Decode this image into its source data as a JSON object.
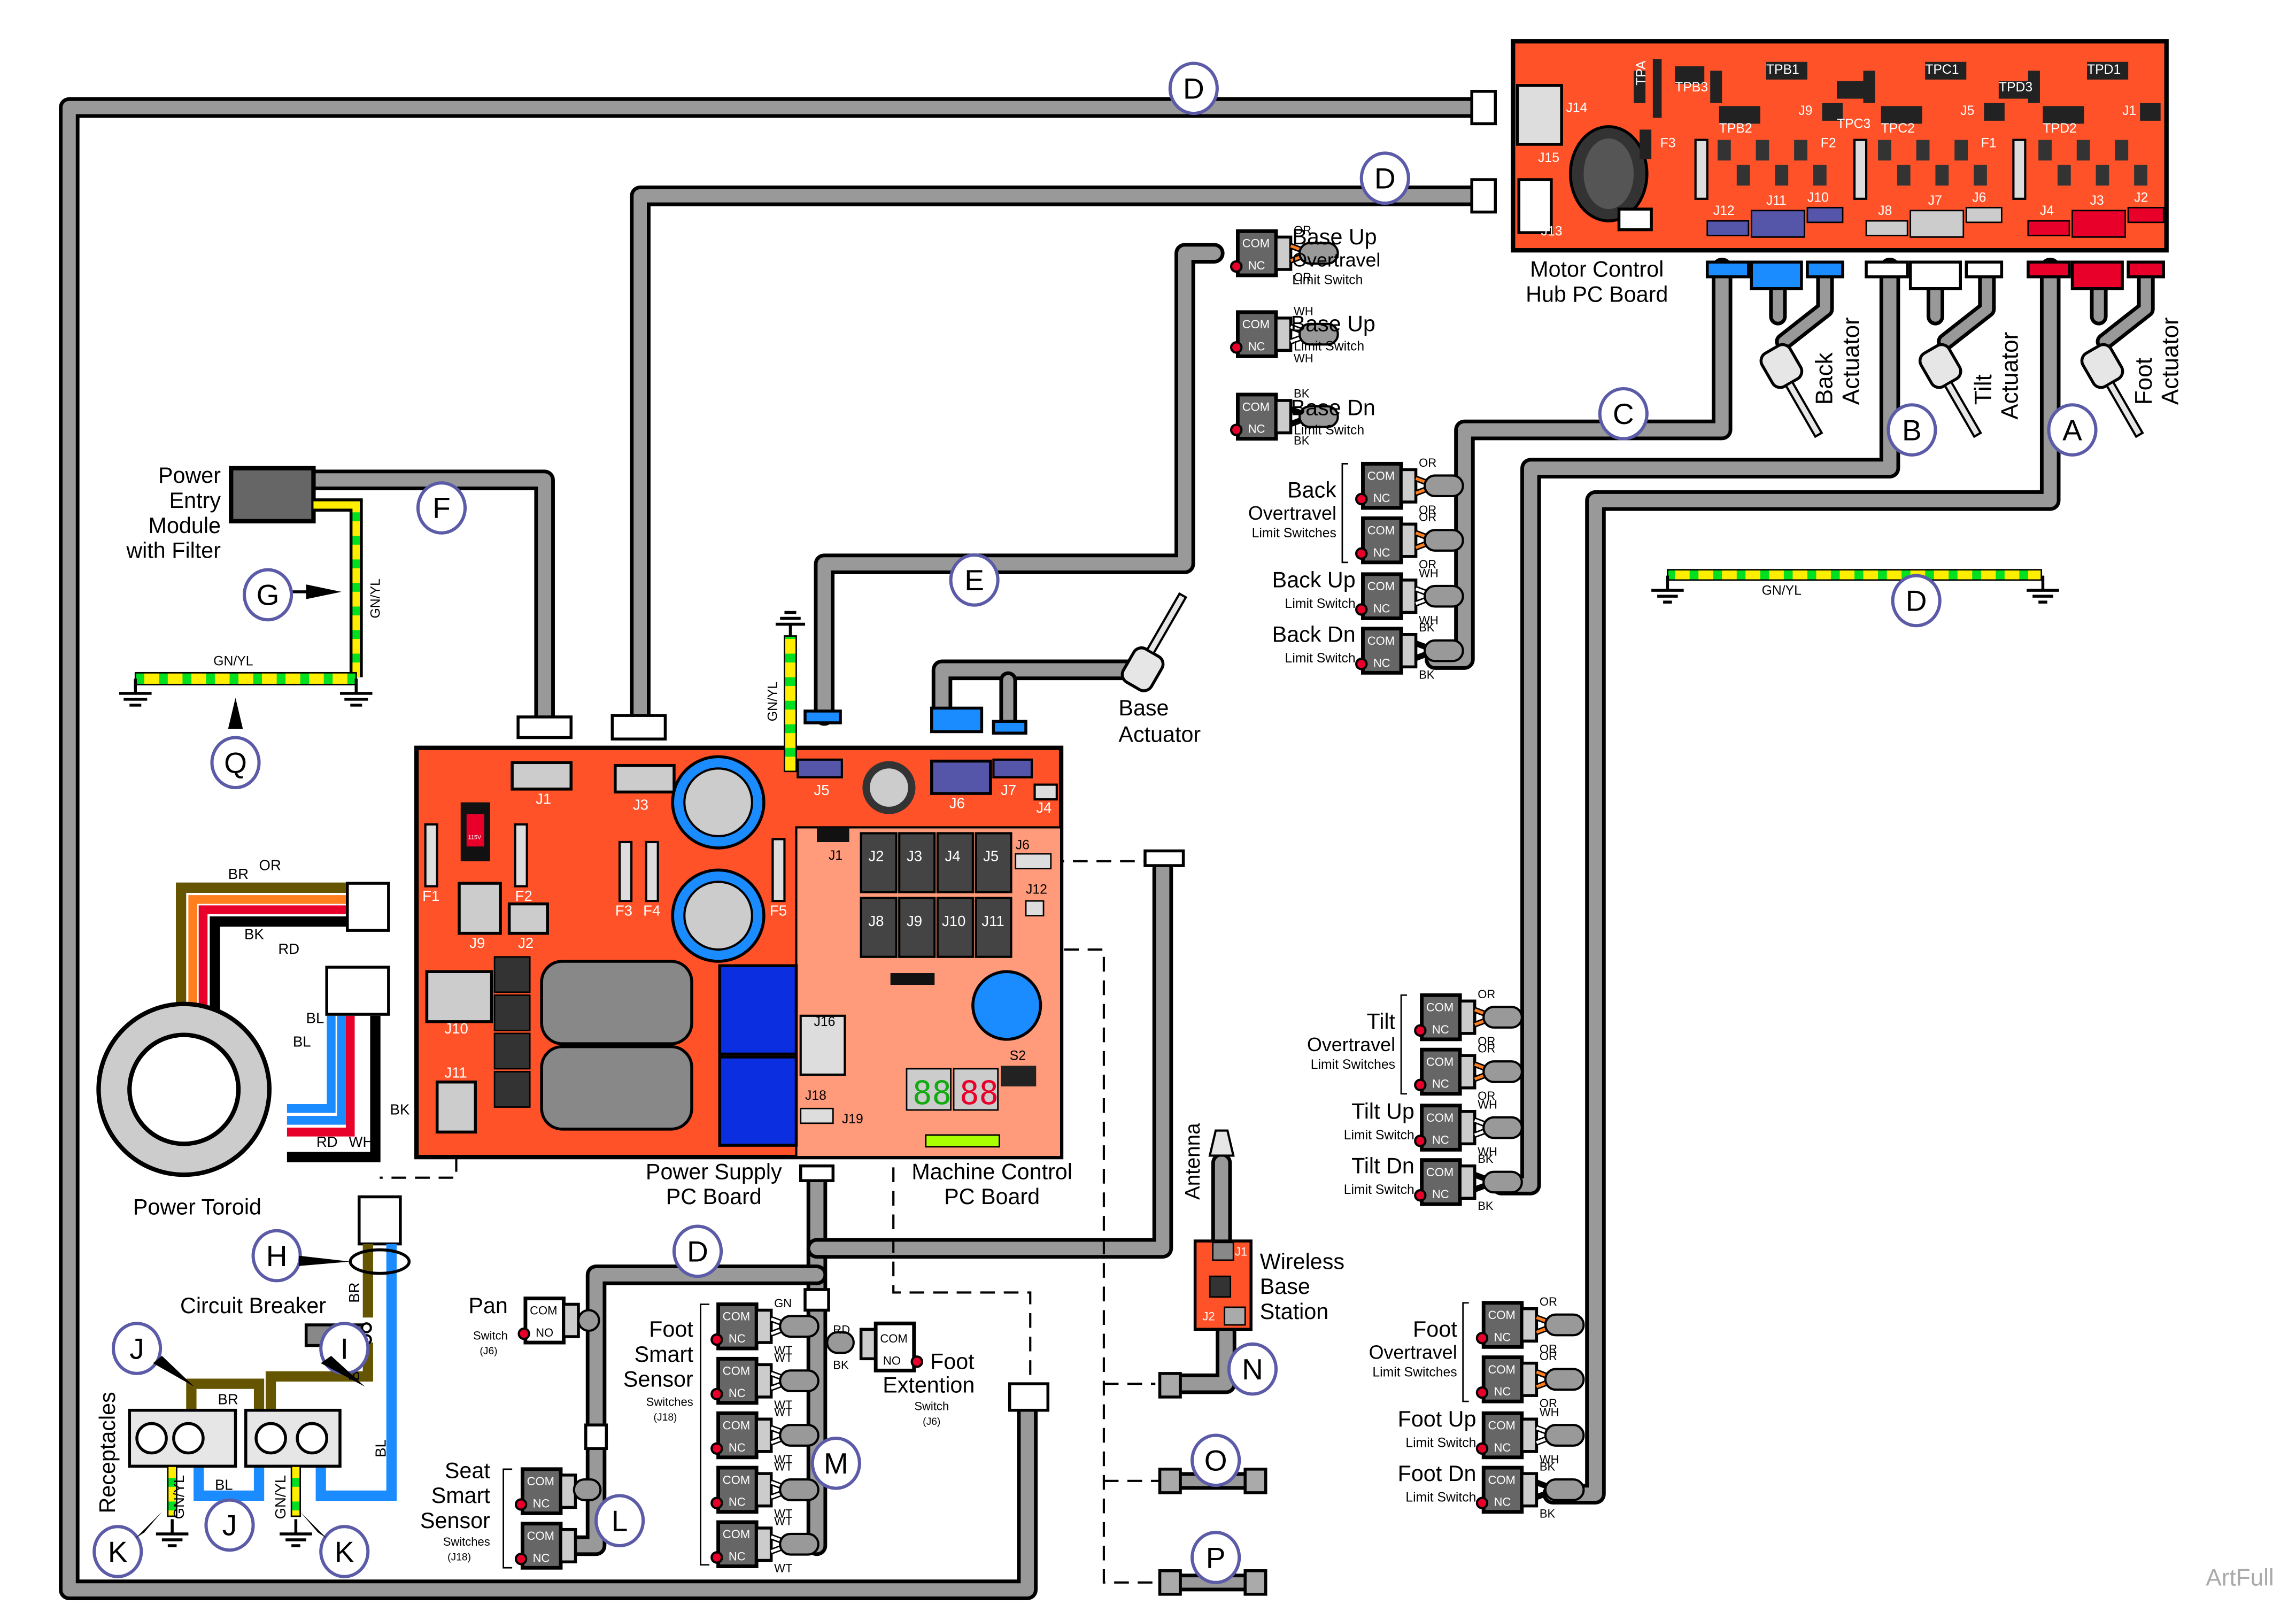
{
  "colors": {
    "board": "#ff5229",
    "board_light": "#ff9a7a",
    "cable": "#999999",
    "callout_ring": "#5b5ba8",
    "switch_body": "#666666",
    "wire_orange": "#ff7f1f",
    "wire_red": "#e8002a",
    "wire_brown": "#665500",
    "wire_blue": "#1a8cff",
    "wire_green": "#00e020",
    "wire_yellow": "#ffee00",
    "conn_blue": "#1a8cff",
    "conn_purple": "#5555aa",
    "conn_red": "#e8002a"
  },
  "boards": {
    "motor_hub": {
      "label_1": "Motor Control",
      "label_2": "Hub PC Board",
      "parts": [
        "TPA",
        "TPB3",
        "TPB1",
        "TPC3",
        "TPC1",
        "TPD3",
        "TPD1",
        "J14",
        "TPB2",
        "J9",
        "TPC2",
        "J5",
        "TPD2",
        "J1",
        "F3",
        "F2",
        "F1",
        "J15",
        "J13",
        "J12",
        "J11",
        "J10",
        "J8",
        "J7",
        "J6",
        "J4",
        "J3",
        "J2"
      ]
    },
    "power_supply": {
      "label_1": "Power Supply",
      "label_2": "PC Board",
      "parts": [
        "J1",
        "J3",
        "F1",
        "F2",
        "F3",
        "F4",
        "F5",
        "J9",
        "J2",
        "J10",
        "J11"
      ],
      "voltage_switch": "115V"
    },
    "machine_control": {
      "label_1": "Machine Control",
      "label_2": "PC Board",
      "parts": [
        "J5",
        "J6",
        "J7",
        "J4",
        "J1",
        "J2",
        "J3",
        "J4",
        "J5",
        "J6",
        "J12",
        "J8",
        "J9",
        "J10",
        "J11",
        "J16",
        "S2",
        "J18",
        "J19"
      ]
    },
    "wireless": {
      "label_1": "Wireless",
      "label_2": "Base",
      "label_3": "Station",
      "j1": "J1",
      "j2": "J2",
      "antenna": "Antenna"
    }
  },
  "components": {
    "power_entry_1": "Power",
    "power_entry_2": "Entry",
    "power_entry_3": "Module",
    "power_entry_4": "with Filter",
    "power_toroid": "Power Toroid",
    "circuit_breaker": "Circuit Breaker",
    "receptacles": "Receptacles",
    "base_actuator_1": "Base",
    "base_actuator_2": "Actuator",
    "back_actuator_1": "Back",
    "back_actuator_2": "Actuator",
    "tilt_actuator_1": "Tilt",
    "tilt_actuator_2": "Actuator",
    "foot_actuator_1": "Foot",
    "foot_actuator_2": "Actuator"
  },
  "switch_groups": [
    {
      "id": "base_up_ot",
      "title": "Base Up",
      "title2": "Overtravel",
      "sub": "Limit Switch",
      "wire": "OR",
      "contacts": [
        "COM",
        "NC"
      ]
    },
    {
      "id": "base_up",
      "title": "Base Up",
      "sub": "Limit Switch",
      "wire": "WH",
      "contacts": [
        "COM",
        "NC"
      ]
    },
    {
      "id": "base_dn",
      "title": "Base Dn",
      "sub": "Limit Switch",
      "wire": "BK",
      "contacts": [
        "COM",
        "NC"
      ]
    },
    {
      "id": "back_ot",
      "title": "Back",
      "title2": "Overtravel",
      "sub": "Limit Switches",
      "wire": "OR",
      "contacts": [
        "COM",
        "NC"
      ]
    },
    {
      "id": "back_up",
      "title": "Back Up",
      "sub": "Limit Switch",
      "wire": "WH",
      "contacts": [
        "COM",
        "NC"
      ]
    },
    {
      "id": "back_dn",
      "title": "Back Dn",
      "sub": "Limit Switch",
      "wire": "BK",
      "contacts": [
        "COM",
        "NC"
      ]
    },
    {
      "id": "tilt_ot",
      "title": "Tilt",
      "title2": "Overtravel",
      "sub": "Limit Switches",
      "wire": "OR",
      "contacts": [
        "COM",
        "NC"
      ]
    },
    {
      "id": "tilt_up",
      "title": "Tilt Up",
      "sub": "Limit Switch",
      "wire": "WH",
      "contacts": [
        "COM",
        "NC"
      ]
    },
    {
      "id": "tilt_dn",
      "title": "Tilt Dn",
      "sub": "Limit Switch",
      "wire": "BK",
      "contacts": [
        "COM",
        "NC"
      ]
    },
    {
      "id": "foot_ot",
      "title": "Foot",
      "title2": "Overtravel",
      "sub": "Limit Switches",
      "wire": "OR",
      "contacts": [
        "COM",
        "NC"
      ]
    },
    {
      "id": "foot_up",
      "title": "Foot Up",
      "sub": "Limit Switch",
      "wire": "WH",
      "contacts": [
        "COM",
        "NC"
      ]
    },
    {
      "id": "foot_dn",
      "title": "Foot Dn",
      "sub": "Limit Switch",
      "wire": "BK",
      "contacts": [
        "COM",
        "NC"
      ]
    },
    {
      "id": "pan",
      "title": "Pan",
      "sub": "Switch",
      "sub2": "(J6)",
      "contacts": [
        "COM",
        "NO"
      ]
    },
    {
      "id": "foot_smart",
      "title": "Foot",
      "title2": "Smart",
      "title3": "Sensor",
      "sub": "Switches",
      "sub2": "(J18)",
      "wire": "WT",
      "wire_first": "GN",
      "contacts": [
        "COM",
        "NC"
      ]
    },
    {
      "id": "seat_smart",
      "title": "Seat",
      "title2": "Smart",
      "title3": "Sensor",
      "sub": "Switches",
      "sub2": "(J18)",
      "contacts": [
        "COM",
        "NC"
      ]
    },
    {
      "id": "foot_ext",
      "title": "Foot",
      "title2": "Extention",
      "sub": "Switch",
      "sub2": "(J6)",
      "wire_a": "RD",
      "wire_b": "BK",
      "contacts": [
        "COM",
        "NO"
      ]
    }
  ],
  "wire_labels": {
    "gnyl": "GN/YL",
    "br": "BR",
    "or": "OR",
    "bk": "BK",
    "rd": "RD",
    "bl": "BL",
    "wh": "WH"
  },
  "callouts": [
    "A",
    "B",
    "C",
    "D",
    "E",
    "F",
    "G",
    "H",
    "I",
    "J",
    "K",
    "L",
    "M",
    "N",
    "O",
    "P",
    "Q"
  ],
  "watermark": "ArtFull"
}
